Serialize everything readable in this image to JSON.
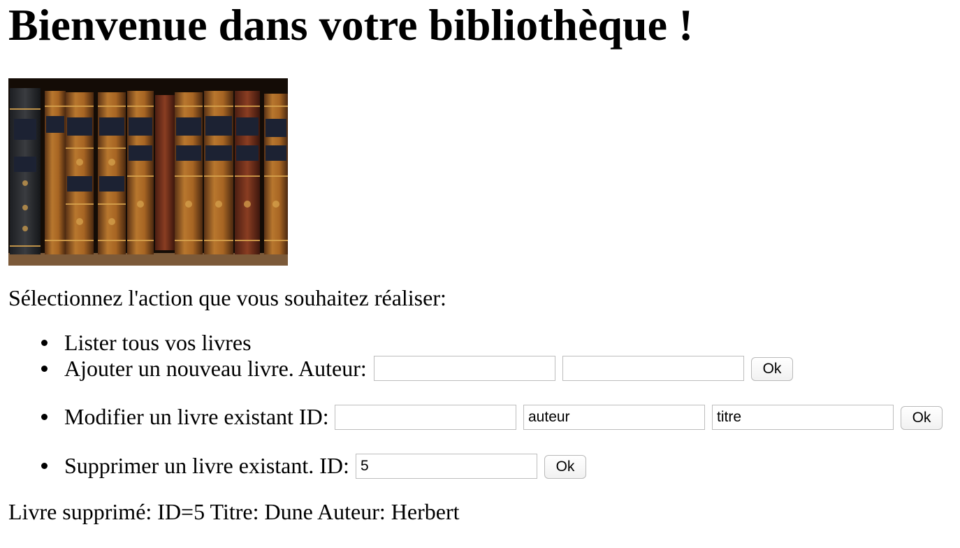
{
  "page": {
    "title": "Bienvenue dans votre bibliothèque !",
    "intro": "Sélectionnez l'action que vous souhaitez réaliser:"
  },
  "banner": {
    "image": "bookshelf-photo",
    "colors": {
      "background": "#140c06",
      "leather": "#8a5526",
      "gold": "#d9a54f",
      "shelf": "#7c5a39"
    }
  },
  "actions": {
    "list": {
      "label": "Lister tous vos livres"
    },
    "add": {
      "label": "Ajouter un nouveau livre. Auteur:",
      "author_value": "",
      "title_value": "",
      "button": "Ok"
    },
    "edit": {
      "label": "Modifier un livre existant ID:",
      "id_value": "",
      "author_value": "auteur",
      "title_value": "titre",
      "button": "Ok"
    },
    "delete": {
      "label": "Supprimer un livre existant. ID:",
      "id_value": "5",
      "button": "Ok"
    }
  },
  "status": "Livre supprimé: ID=5 Titre: Dune Auteur: Herbert"
}
